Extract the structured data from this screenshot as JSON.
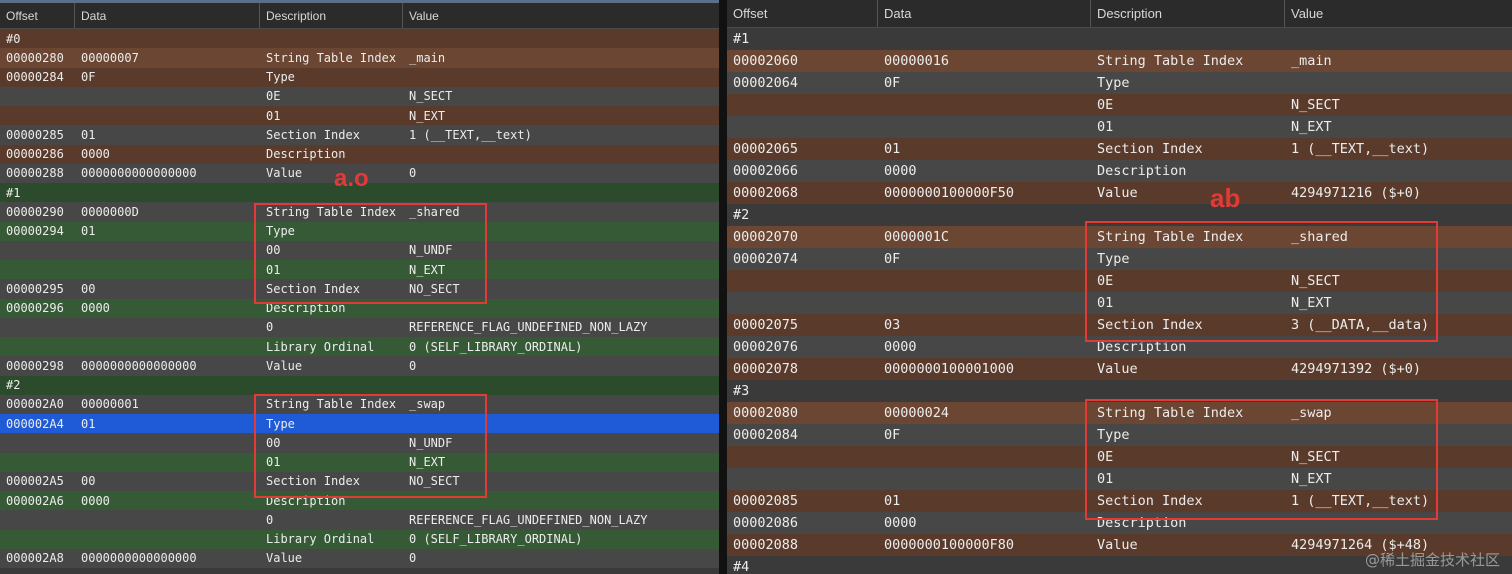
{
  "left": {
    "columns": [
      "Offset",
      "Data",
      "Description",
      "Value"
    ],
    "label": "a.o",
    "rows": [
      {
        "o": "#0",
        "d": "",
        "s": "",
        "v": "",
        "bg": "brown-a"
      },
      {
        "o": "00000280",
        "d": "00000007",
        "s": "String Table Index",
        "v": "_main",
        "bg": "brown-b"
      },
      {
        "o": "00000284",
        "d": "0F",
        "s": "Type",
        "v": "",
        "bg": "brown-a"
      },
      {
        "o": "",
        "d": "",
        "s": "0E",
        "v": "N_SECT",
        "bg": "gray-b"
      },
      {
        "o": "",
        "d": "",
        "s": "01",
        "v": "N_EXT",
        "bg": "brown-a"
      },
      {
        "o": "00000285",
        "d": "01",
        "s": "Section Index",
        "v": "1 (__TEXT,__text)",
        "bg": "gray-b"
      },
      {
        "o": "00000286",
        "d": "0000",
        "s": "Description",
        "v": "",
        "bg": "brown-a"
      },
      {
        "o": "00000288",
        "d": "0000000000000000",
        "s": "Value",
        "v": "0",
        "bg": "gray-b"
      },
      {
        "o": "#1",
        "d": "",
        "s": "",
        "v": "",
        "bg": "green-a"
      },
      {
        "o": "00000290",
        "d": "0000000D",
        "s": "String Table Index",
        "v": "_shared",
        "bg": "gray-b"
      },
      {
        "o": "00000294",
        "d": "01",
        "s": "Type",
        "v": "",
        "bg": "green-b"
      },
      {
        "o": "",
        "d": "",
        "s": "00",
        "v": "N_UNDF",
        "bg": "gray-b"
      },
      {
        "o": "",
        "d": "",
        "s": "01",
        "v": "N_EXT",
        "bg": "green-b"
      },
      {
        "o": "00000295",
        "d": "00",
        "s": "Section Index",
        "v": "NO_SECT",
        "bg": "gray-b"
      },
      {
        "o": "00000296",
        "d": "0000",
        "s": "Description",
        "v": "",
        "bg": "green-b"
      },
      {
        "o": "",
        "d": "",
        "s": "0",
        "v": "REFERENCE_FLAG_UNDEFINED_NON_LAZY",
        "bg": "gray-b"
      },
      {
        "o": "",
        "d": "",
        "s": "Library Ordinal",
        "v": "0 (SELF_LIBRARY_ORDINAL)",
        "bg": "green-b"
      },
      {
        "o": "00000298",
        "d": "0000000000000000",
        "s": "Value",
        "v": "0",
        "bg": "gray-b"
      },
      {
        "o": "#2",
        "d": "",
        "s": "",
        "v": "",
        "bg": "green-a"
      },
      {
        "o": "000002A0",
        "d": "00000001",
        "s": "String Table Index",
        "v": "_swap",
        "bg": "gray-b"
      },
      {
        "o": "000002A4",
        "d": "01",
        "s": "Type",
        "v": "",
        "bg": "blue"
      },
      {
        "o": "",
        "d": "",
        "s": "00",
        "v": "N_UNDF",
        "bg": "gray-b"
      },
      {
        "o": "",
        "d": "",
        "s": "01",
        "v": "N_EXT",
        "bg": "green-b"
      },
      {
        "o": "000002A5",
        "d": "00",
        "s": "Section Index",
        "v": "NO_SECT",
        "bg": "gray-b"
      },
      {
        "o": "000002A6",
        "d": "0000",
        "s": "Description",
        "v": "",
        "bg": "green-b"
      },
      {
        "o": "",
        "d": "",
        "s": "0",
        "v": "REFERENCE_FLAG_UNDEFINED_NON_LAZY",
        "bg": "gray-b"
      },
      {
        "o": "",
        "d": "",
        "s": "Library Ordinal",
        "v": "0 (SELF_LIBRARY_ORDINAL)",
        "bg": "green-b"
      },
      {
        "o": "000002A8",
        "d": "0000000000000000",
        "s": "Value",
        "v": "0",
        "bg": "gray-b"
      }
    ]
  },
  "right": {
    "columns": [
      "Offset",
      "Data",
      "Description",
      "Value"
    ],
    "label": "ab",
    "rows": [
      {
        "o": "#1",
        "d": "",
        "s": "",
        "v": "",
        "bg": "gray-a"
      },
      {
        "o": "00002060",
        "d": "00000016",
        "s": "String Table Index",
        "v": "_main",
        "bg": "brown-b"
      },
      {
        "o": "00002064",
        "d": "0F",
        "s": "Type",
        "v": "",
        "bg": "gray-b"
      },
      {
        "o": "",
        "d": "",
        "s": "0E",
        "v": "N_SECT",
        "bg": "brown-a"
      },
      {
        "o": "",
        "d": "",
        "s": "01",
        "v": "N_EXT",
        "bg": "gray-b"
      },
      {
        "o": "00002065",
        "d": "01",
        "s": "Section Index",
        "v": "1 (__TEXT,__text)",
        "bg": "brown-a"
      },
      {
        "o": "00002066",
        "d": "0000",
        "s": "Description",
        "v": "",
        "bg": "gray-b"
      },
      {
        "o": "00002068",
        "d": "0000000100000F50",
        "s": "Value",
        "v": "4294971216 ($+0)",
        "bg": "brown-a"
      },
      {
        "o": "#2",
        "d": "",
        "s": "",
        "v": "",
        "bg": "gray-a"
      },
      {
        "o": "00002070",
        "d": "0000001C",
        "s": "String Table Index",
        "v": "_shared",
        "bg": "brown-b"
      },
      {
        "o": "00002074",
        "d": "0F",
        "s": "Type",
        "v": "",
        "bg": "gray-b"
      },
      {
        "o": "",
        "d": "",
        "s": "0E",
        "v": "N_SECT",
        "bg": "brown-a"
      },
      {
        "o": "",
        "d": "",
        "s": "01",
        "v": "N_EXT",
        "bg": "gray-b"
      },
      {
        "o": "00002075",
        "d": "03",
        "s": "Section Index",
        "v": "3 (__DATA,__data)",
        "bg": "brown-a"
      },
      {
        "o": "00002076",
        "d": "0000",
        "s": "Description",
        "v": "",
        "bg": "gray-b"
      },
      {
        "o": "00002078",
        "d": "0000000100001000",
        "s": "Value",
        "v": "4294971392 ($+0)",
        "bg": "brown-a"
      },
      {
        "o": "#3",
        "d": "",
        "s": "",
        "v": "",
        "bg": "gray-a"
      },
      {
        "o": "00002080",
        "d": "00000024",
        "s": "String Table Index",
        "v": "_swap",
        "bg": "brown-b"
      },
      {
        "o": "00002084",
        "d": "0F",
        "s": "Type",
        "v": "",
        "bg": "gray-b"
      },
      {
        "o": "",
        "d": "",
        "s": "0E",
        "v": "N_SECT",
        "bg": "brown-a"
      },
      {
        "o": "",
        "d": "",
        "s": "01",
        "v": "N_EXT",
        "bg": "gray-b"
      },
      {
        "o": "00002085",
        "d": "01",
        "s": "Section Index",
        "v": "1 (__TEXT,__text)",
        "bg": "brown-a"
      },
      {
        "o": "00002086",
        "d": "0000",
        "s": "Description",
        "v": "",
        "bg": "gray-b"
      },
      {
        "o": "00002088",
        "d": "0000000100000F80",
        "s": "Value",
        "v": "4294971264 ($+48)",
        "bg": "brown-a"
      },
      {
        "o": "#4",
        "d": "",
        "s": "",
        "v": "",
        "bg": "gray-a"
      }
    ]
  },
  "watermark": "@稀土掘金技术社区",
  "colors": {
    "highlight_box": "#e23a36",
    "selected_row": "#1f5bd6"
  }
}
